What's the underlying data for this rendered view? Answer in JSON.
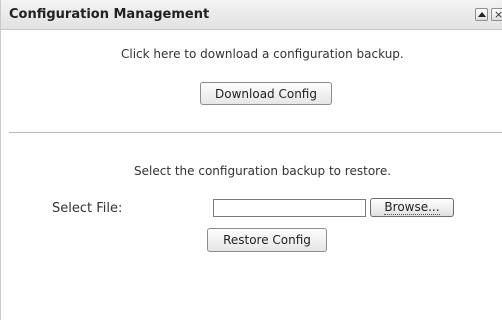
{
  "panel": {
    "title": "Configuration Management"
  },
  "backup": {
    "instruction": "Click here to download a configuration backup.",
    "download_label": "Download Config"
  },
  "restore": {
    "instruction": "Select the configuration backup to restore.",
    "select_file_label": "Select File:",
    "file_value": "",
    "browse_label": "Browse...",
    "restore_label": "Restore Config"
  },
  "icons": {
    "collapse": "chevron-up-icon",
    "close": "close-icon"
  }
}
